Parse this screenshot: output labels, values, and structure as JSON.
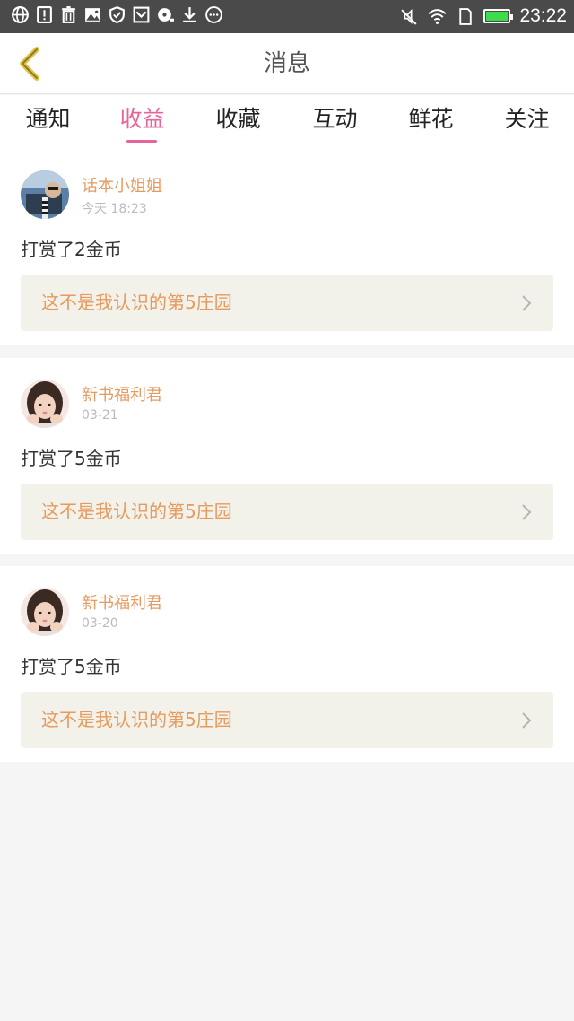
{
  "status_bar": {
    "time": "23:22",
    "left_icons": [
      "globe-icon",
      "alert-icon",
      "trash-icon",
      "image-icon",
      "shield-icon",
      "inbox-icon",
      "speed-icon",
      "download-icon",
      "more-icon"
    ],
    "right_icons": [
      "mute-icon",
      "wifi-icon",
      "sim-icon",
      "battery-icon"
    ],
    "battery_level": 1.0,
    "battery_color": "#3ddc4a"
  },
  "header": {
    "title": "消息",
    "back_icon": "chevron-left-icon",
    "back_color": "#e6c53a"
  },
  "tabs": [
    {
      "label": "通知",
      "active": false
    },
    {
      "label": "收益",
      "active": true
    },
    {
      "label": "收藏",
      "active": false
    },
    {
      "label": "互动",
      "active": false
    },
    {
      "label": "鲜花",
      "active": false
    },
    {
      "label": "关注",
      "active": false
    }
  ],
  "accent_color": "#e5649a",
  "messages": [
    {
      "username": "话本小姐姐",
      "time": "今天 18:23",
      "action": "打赏了2金币",
      "book_title": "这不是我认识的第5庄园"
    },
    {
      "username": "新书福利君",
      "time": "03-21",
      "action": "打赏了5金币",
      "book_title": "这不是我认识的第5庄园"
    },
    {
      "username": "新书福利君",
      "time": "03-20",
      "action": "打赏了5金币",
      "book_title": "这不是我认识的第5庄园"
    }
  ]
}
